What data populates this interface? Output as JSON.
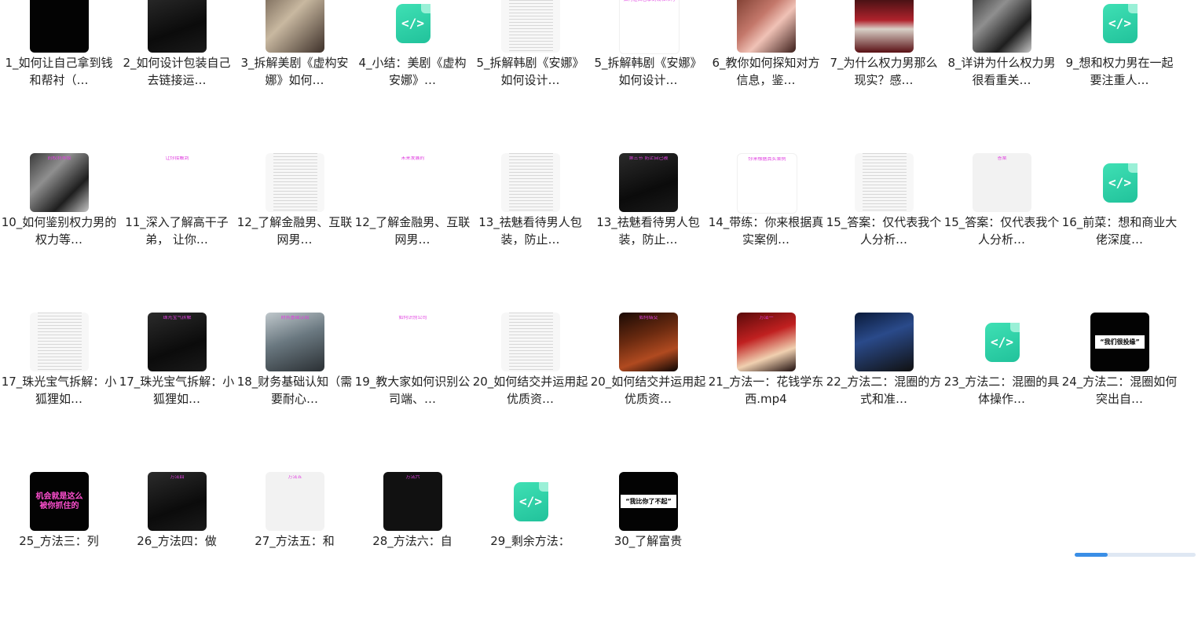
{
  "files": [
    {
      "label": "1_如何让自己拿到钱和帮衬（…",
      "thumb": "black",
      "caption": ""
    },
    {
      "label": "2_如何设计包装自己去链接运…",
      "thumb": "dark1",
      "caption": ""
    },
    {
      "label": "3_拆解美剧《虚构安娜》如何…",
      "thumb": "photo-room",
      "caption": ""
    },
    {
      "label": "4_小结：美剧《虚构安娜》…",
      "thumb": "code",
      "caption": ""
    },
    {
      "label": "5_拆解韩剧《安娜》如何设计…",
      "thumb": "doc",
      "caption": ""
    },
    {
      "label": "5_拆解韩剧《安娜》如何设计…",
      "thumb": "white",
      "caption": "如何让自己拿到钱和帮衬"
    },
    {
      "label": "6_教你如何探知对方信息，鉴…",
      "thumb": "photo-warm",
      "caption": ""
    },
    {
      "label": "7_为什么权力男那么现实？感…",
      "thumb": "photo-red",
      "caption": ""
    },
    {
      "label": "8_详讲为什么权力男很看重关…",
      "thumb": "photo-office",
      "caption": ""
    },
    {
      "label": "9_想和权力男在一起要注重人…",
      "thumb": "code",
      "caption": ""
    },
    {
      "label": "10_如何鉴别权力男的权力等…",
      "thumb": "photo-office",
      "caption": "的权利等级"
    },
    {
      "label": "11_深入了解高干子弟， 让你…",
      "thumb": "slide",
      "caption": "让你接触到"
    },
    {
      "label": "12_了解金融男、互联网男…",
      "thumb": "doc",
      "caption": ""
    },
    {
      "label": "12_了解金融男、互联网男…",
      "thumb": "slide",
      "caption": "未来发展的"
    },
    {
      "label": "13_祛魅看待男人包装，防止…",
      "thumb": "doc",
      "caption": ""
    },
    {
      "label": "13_祛魅看待男人包装，防止…",
      "thumb": "dark1",
      "caption": "第三节 防止自己被"
    },
    {
      "label": "14_带练：你来根据真实案例…",
      "thumb": "white",
      "caption": "你来根据真实案例"
    },
    {
      "label": "15_答案：仅代表我个人分析…",
      "thumb": "doc",
      "caption": ""
    },
    {
      "label": "15_答案：仅代表我个人分析…",
      "thumb": "chat",
      "caption": "答案"
    },
    {
      "label": "16_前菜：想和商业大佬深度…",
      "thumb": "code",
      "caption": ""
    },
    {
      "label": "17_珠光宝气拆解：小狐狸如…",
      "thumb": "doc",
      "caption": ""
    },
    {
      "label": "17_珠光宝气拆解：小狐狸如…",
      "thumb": "dark1",
      "caption": "珠光宝气拆解"
    },
    {
      "label": "18_财务基础认知（需要耐心…",
      "thumb": "photo-street",
      "caption": "财务基础认知"
    },
    {
      "label": "19_教大家如何识别公司端、…",
      "thumb": "slide",
      "caption": "如何识别公司"
    },
    {
      "label": "20_如何结交并运用起优质资…",
      "thumb": "doc",
      "caption": ""
    },
    {
      "label": "20_如何结交并运用起优质资…",
      "thumb": "photo-fire",
      "caption": "如何结交"
    },
    {
      "label": "21_方法一：花钱学东西.mp4",
      "thumb": "photo-bright",
      "caption": "方法一"
    },
    {
      "label": "22_方法二：混圈的方式和准…",
      "thumb": "photo-night",
      "caption": ""
    },
    {
      "label": "23_方法二：混圈的具体操作…",
      "thumb": "code",
      "caption": ""
    },
    {
      "label": "24_方法二：混圈如何突出自…",
      "thumb": "black",
      "caption": "“我们很投缘”"
    },
    {
      "label": "25_方法三：列",
      "thumb": "black",
      "caption": "机会就是这么被你抓住的"
    },
    {
      "label": "26_方法四：做",
      "thumb": "dark1",
      "caption": "方法四"
    },
    {
      "label": "27_方法五：和",
      "thumb": "chat",
      "caption": "方法五"
    },
    {
      "label": "28_方法六：自",
      "thumb": "apps",
      "caption": "方法六"
    },
    {
      "label": "29_剩余方法：",
      "thumb": "code",
      "caption": ""
    },
    {
      "label": "30_了解富贵",
      "thumb": "black",
      "caption": "“我比你了不起”"
    }
  ],
  "code_glyph": "</>"
}
